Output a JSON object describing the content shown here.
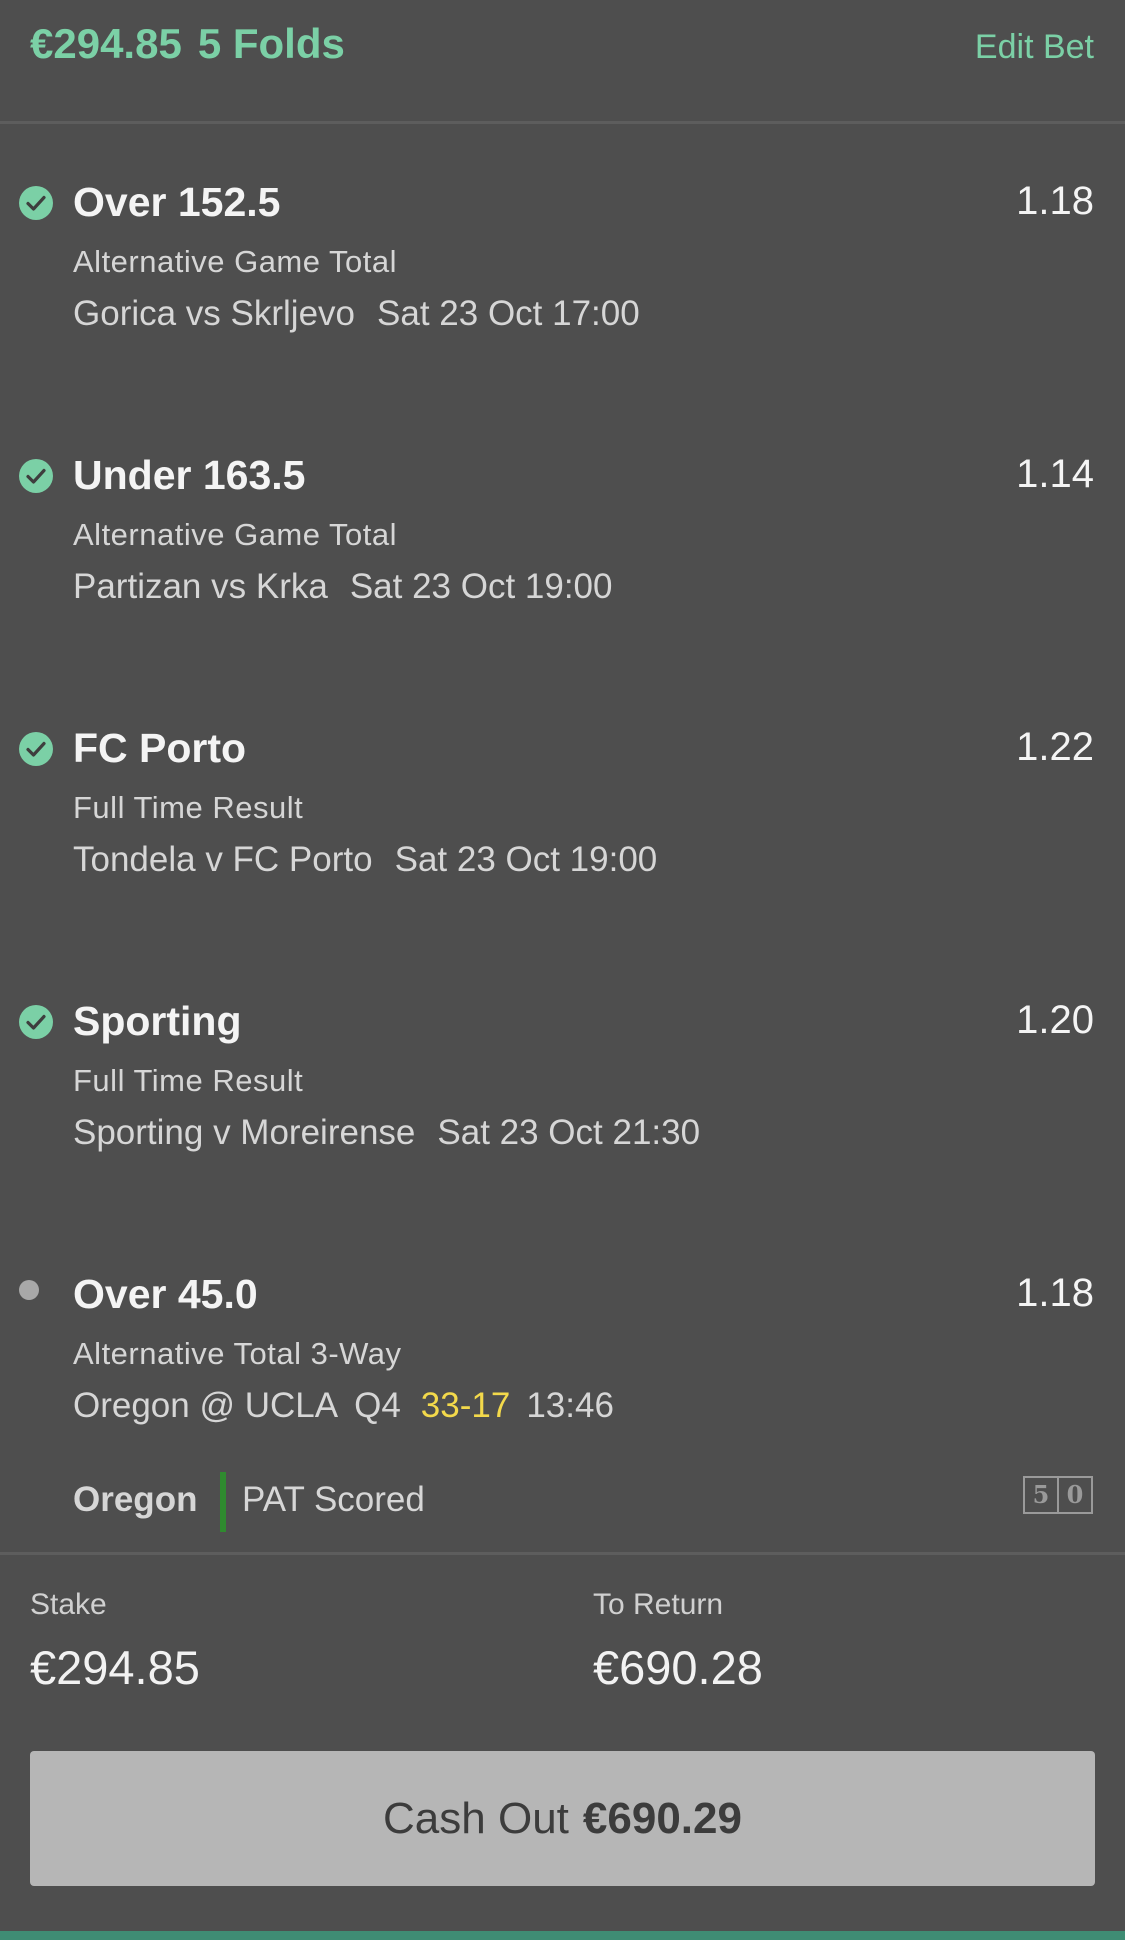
{
  "header": {
    "amount": "€294.85",
    "bet_type": "5 Folds",
    "edit_label": "Edit Bet"
  },
  "selections": [
    {
      "status": "check-icon",
      "name": "Over 152.5",
      "odds": "1.18",
      "market": "Alternative Game Total",
      "event": "Gorica vs Skrljevo",
      "time": "Sat 23 Oct 17:00"
    },
    {
      "status": "check-icon",
      "name": "Under 163.5",
      "odds": "1.14",
      "market": "Alternative Game Total",
      "event": "Partizan vs Krka",
      "time": "Sat 23 Oct 19:00"
    },
    {
      "status": "check-icon",
      "name": "FC Porto",
      "odds": "1.22",
      "market": "Full Time Result",
      "event": "Tondela v FC Porto",
      "time": "Sat 23 Oct 19:00"
    },
    {
      "status": "check-icon",
      "name": "Sporting",
      "odds": "1.20",
      "market": "Full Time Result",
      "event": "Sporting v Moreirense",
      "time": "Sat 23 Oct 21:30"
    },
    {
      "status": "pending-dot-icon",
      "name": "Over 45.0",
      "odds": "1.18",
      "market": "Alternative Total 3-Way",
      "event": "Oregon @ UCLA",
      "quarter": "Q4",
      "score": "33-17",
      "clock": "13:46"
    }
  ],
  "live": {
    "team": "Oregon",
    "event": "PAT Scored",
    "scoreboard_digits": [
      "5",
      "0"
    ],
    "bar_color": "#2f8a2f"
  },
  "summary": {
    "stake_label": "Stake",
    "stake_value": "€294.85",
    "return_label": "To Return",
    "return_value": "€690.28"
  },
  "cashout": {
    "label": "Cash Out",
    "amount": "€690.29"
  },
  "colors": {
    "accent": "#7bd0a6",
    "background": "#4e4e4e",
    "score": "#f3d94b",
    "button": "#b6b6b6"
  }
}
